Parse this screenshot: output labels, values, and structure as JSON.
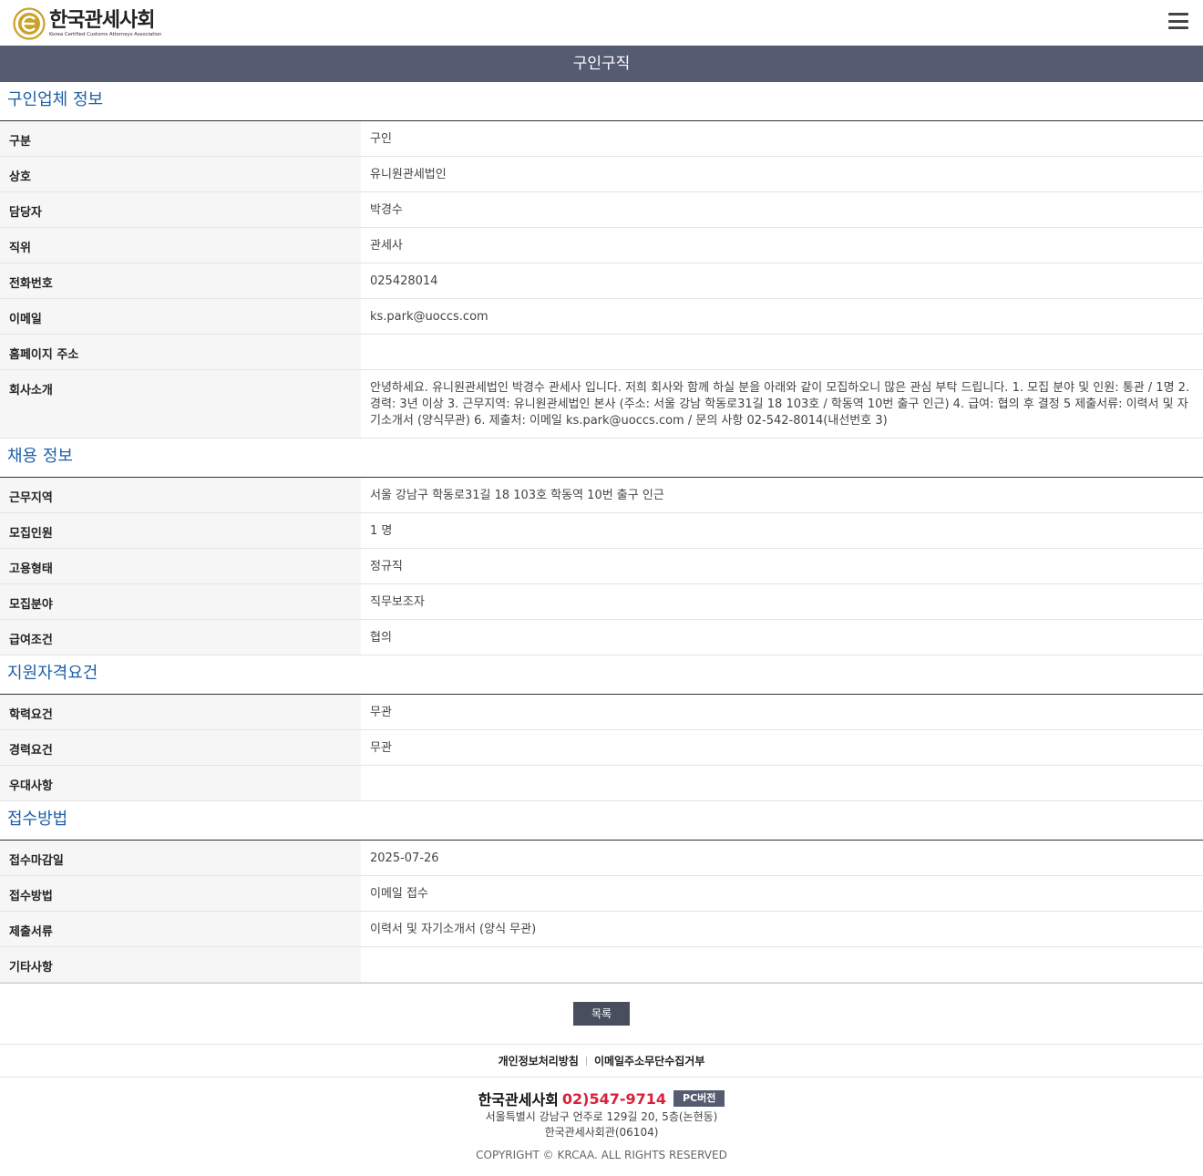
{
  "header": {
    "logo_name": "한국관세사회",
    "logo_sub": "Korea Certified Customs Attorneys Association"
  },
  "page_title": "구인구직",
  "company": {
    "title": "구인업체 정보",
    "rows": [
      {
        "label": "구분",
        "value": "구인"
      },
      {
        "label": "상호",
        "value": "유니원관세법인"
      },
      {
        "label": "담당자",
        "value": "박경수"
      },
      {
        "label": "직위",
        "value": "관세사"
      },
      {
        "label": "전화번호",
        "value": "025428014"
      },
      {
        "label": "이메일",
        "value": "ks.park@uoccs.com"
      },
      {
        "label": "홈페이지 주소",
        "value": ""
      },
      {
        "label": "회사소개",
        "value": "안녕하세요. 유니원관세법인 박경수 관세사 입니다. 저희 회사와 함께 하실 분을 아래와 같이 모집하오니 많은 관심 부탁 드립니다. 1. 모집 분야 및 인원: 통관 / 1명 2. 경력: 3년 이상 3. 근무지역: 유니원관세법인 본사 (주소: 서울 강남 학동로31길 18 103호 / 학동역 10번 출구 인근) 4. 급여: 협의 후 결정 5 제출서류: 이력서 및 자기소개서 (양식무관) 6. 제출처: 이메일 ks.park@uoccs.com / 문의 사항 02-542-8014(내선번호 3)"
      }
    ]
  },
  "recruit": {
    "title": "채용 정보",
    "rows": [
      {
        "label": "근무지역",
        "value": "서울 강남구 학동로31길 18 103호 학동역 10번 출구 인근"
      },
      {
        "label": "모집인원",
        "value": "1 명"
      },
      {
        "label": "고용형태",
        "value": "정규직"
      },
      {
        "label": "모집분야",
        "value": "직무보조자"
      },
      {
        "label": "급여조건",
        "value": "협의"
      }
    ]
  },
  "qualify": {
    "title": "지원자격요건",
    "rows": [
      {
        "label": "학력요건",
        "value": "무관"
      },
      {
        "label": "경력요건",
        "value": "무관"
      },
      {
        "label": "우대사항",
        "value": ""
      }
    ]
  },
  "apply": {
    "title": "접수방법",
    "rows": [
      {
        "label": "접수마감일",
        "value": "2025-07-26"
      },
      {
        "label": "접수방법",
        "value": "이메일 접수"
      },
      {
        "label": "제출서류",
        "value": "이력서 및 자기소개서 (양식 무관)"
      },
      {
        "label": "기타사항",
        "value": ""
      }
    ]
  },
  "list_button": "목록",
  "footer": {
    "link_privacy": "개인정보처리방침",
    "link_email": "이메일주소무단수집거부",
    "org_name": "한국관세사회",
    "phone": "02)547-9714",
    "pc_button": "PC버전",
    "address1": "서울특별시 강남구 언주로 129길 20, 5층(논현동)",
    "address2": "한국관세사회관(06104)",
    "copyright": "COPYRIGHT © KRCAA. ALL RIGHTS RESERVED"
  },
  "colors": {
    "title_bar": "#555b70",
    "section_title": "#1f5fa8",
    "phone": "#d9213b",
    "logo_gold": "#c9a227"
  }
}
